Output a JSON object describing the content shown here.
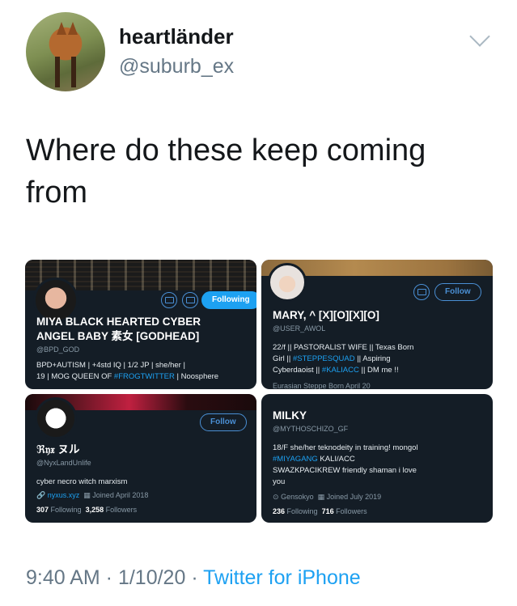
{
  "tweet": {
    "author_name": "heartländer",
    "author_handle": "@suburb_ex",
    "text": "Where do these keep coming from",
    "time": "9:40 AM",
    "date": "1/10/20",
    "separator": " · ",
    "source": "Twitter for iPhone"
  },
  "cards": [
    {
      "follow_label": "Following",
      "name_line1": "MIYA BLACK HEARTED CYBER",
      "name_line2": "ANGEL BABY 素女 [GODHEAD]",
      "handle": "@BPD_GOD",
      "bio_line1": "BPD+AUTISM | +4std IQ | 1/2 JP | she/her |",
      "bio_line2_pre": "19 | MOG QUEEN OF ",
      "bio_line2_link": "#FROGTWITTER",
      "bio_line2_post": " | Noosphere"
    },
    {
      "follow_label": "Follow",
      "name": "MARY, ^ [X][O][X][O]",
      "handle": "@USER_AWOL",
      "bio_line1": "22/f  || PASTORALIST WIFE ||  Texas Born",
      "bio_line2_pre": "Girl  || ",
      "bio_line2_link": "#STEPPESQUAD",
      "bio_line2_post": " || Aspiring",
      "bio_line3_pre": "Cyberdaoist ||  ",
      "bio_line3_link": "#KALIACC",
      "bio_line3_post": "  || DM me !!",
      "meta_cut": "Eurasian Steppe    Born April 20"
    },
    {
      "follow_label": "Follow",
      "name": "ℜ𝔶𝔵 ヌル",
      "handle": "@NyxLandUnlife",
      "bio_line1": "cyber necro witch marxism",
      "link": "nyxus.xyz",
      "joined": "Joined April 2018",
      "following_count": "307",
      "following_label": "Following",
      "followers_count": "3,258",
      "followers_label": "Followers"
    },
    {
      "name": "MILKY",
      "handle": "@MYTHOSCHIZO_GF",
      "bio_line1": "18/F she/her    teknodeity in training!    mongol",
      "bio_line2_link": "#MIYAGANG",
      "bio_line2_post": "  KALI/ACC",
      "bio_line3": "SWAZKPACIKREW    friendly shaman    i love",
      "bio_line4": "you",
      "location": "Gensokyo",
      "joined": "Joined July 2019",
      "following_count": "236",
      "following_label": "Following",
      "followers_count": "716",
      "followers_label": "Followers"
    }
  ],
  "colors": {
    "accent": "#1da1f2",
    "card_bg": "#141d26",
    "muted": "#657786"
  }
}
